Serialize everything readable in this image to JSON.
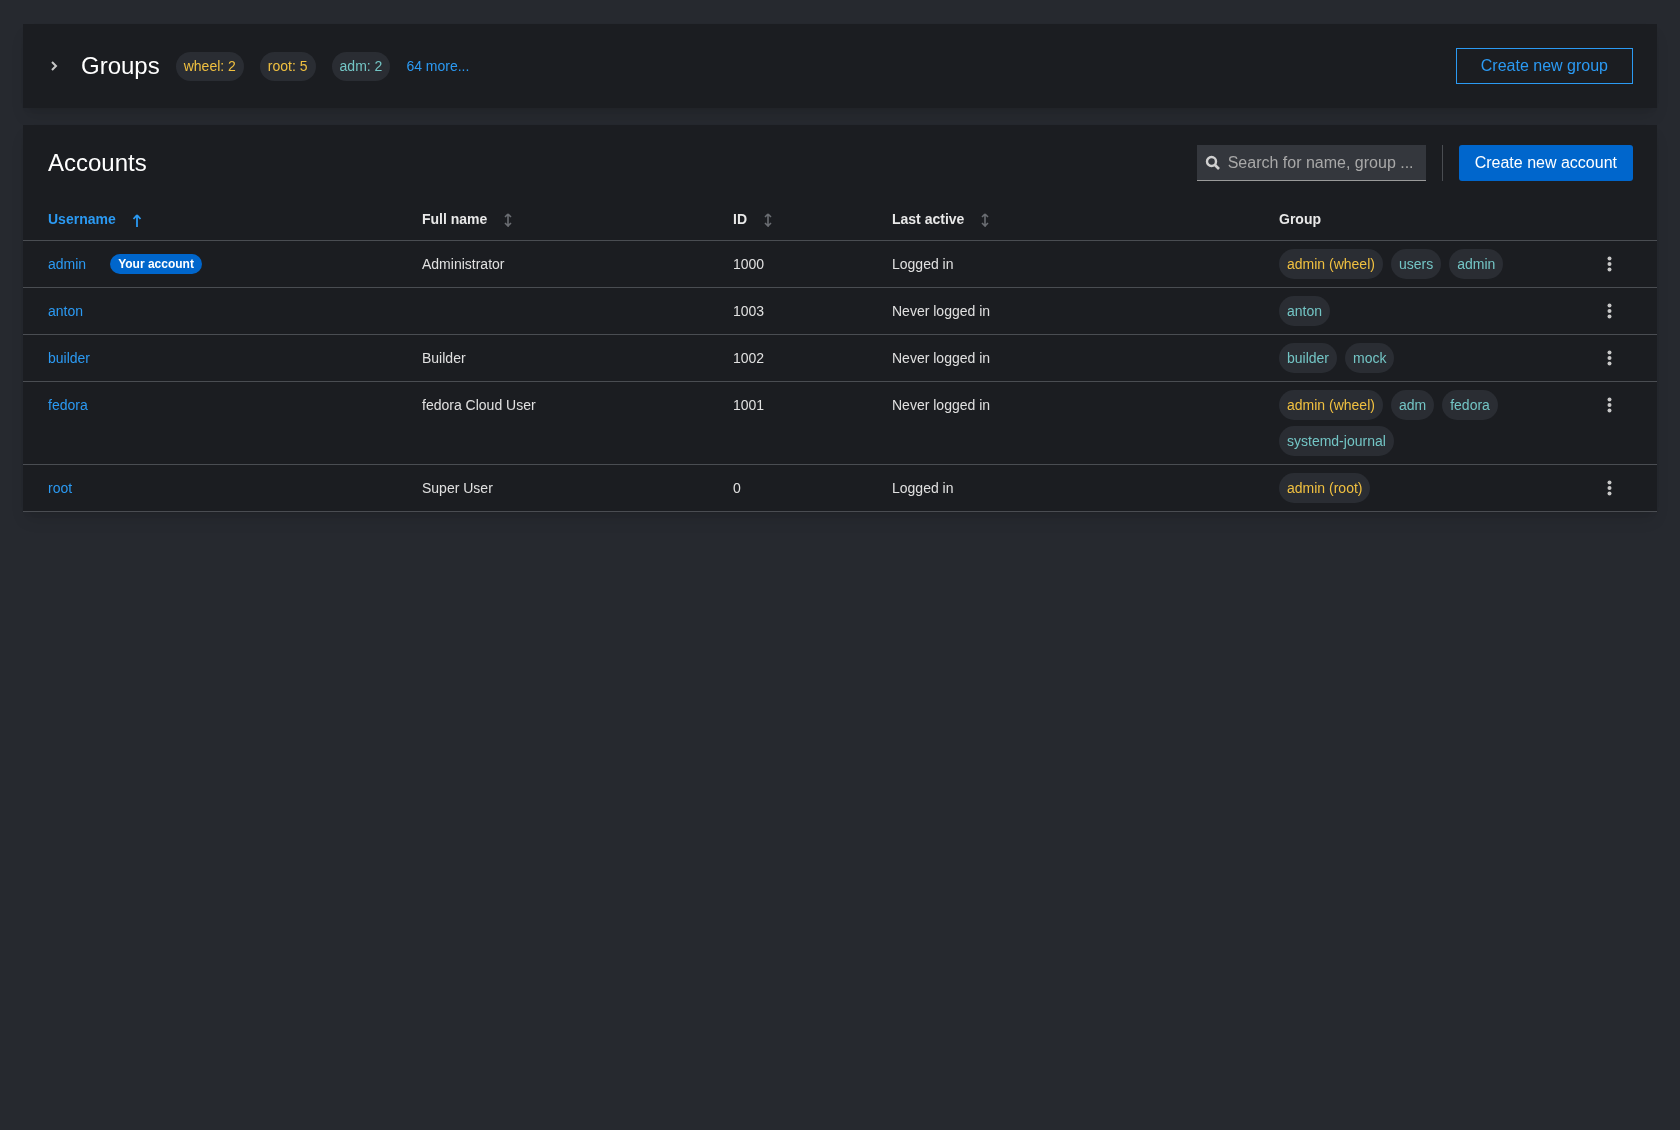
{
  "groups_card": {
    "title": "Groups",
    "expanded": false,
    "chips": [
      {
        "label": "wheel: 2",
        "color": "#f0c040"
      },
      {
        "label": "root: 5",
        "color": "#f0c040"
      },
      {
        "label": "adm: 2",
        "color": "#73c5c5"
      }
    ],
    "more_link": "64 more...",
    "button": "Create new group"
  },
  "accounts": {
    "title": "Accounts",
    "search": {
      "placeholder": "Search for name, group ..."
    },
    "button": "Create new account",
    "columns": [
      {
        "label": "Username",
        "sortable": true,
        "selected": true
      },
      {
        "label": "Full name",
        "sortable": true,
        "selected": false
      },
      {
        "label": "ID",
        "sortable": true,
        "selected": false
      },
      {
        "label": "Last active",
        "sortable": true,
        "selected": false
      },
      {
        "label": "Group",
        "sortable": false,
        "selected": false
      }
    ],
    "rows": [
      {
        "username": "admin",
        "badge": "Your account",
        "full_name": "Administrator",
        "id": "1000",
        "last_active": "Logged in",
        "groups": [
          {
            "label": "admin (wheel)",
            "color": "#f0c040"
          },
          {
            "label": "users",
            "color": "#73c5c5"
          },
          {
            "label": "admin",
            "color": "#73c5c5"
          }
        ]
      },
      {
        "username": "anton",
        "full_name": "",
        "id": "1003",
        "last_active": "Never logged in",
        "groups": [
          {
            "label": "anton",
            "color": "#73c5c5"
          }
        ]
      },
      {
        "username": "builder",
        "full_name": "Builder",
        "id": "1002",
        "last_active": "Never logged in",
        "groups": [
          {
            "label": "builder",
            "color": "#73c5c5"
          },
          {
            "label": "mock",
            "color": "#73c5c5"
          }
        ]
      },
      {
        "username": "fedora",
        "full_name": "fedora Cloud User",
        "id": "1001",
        "last_active": "Never logged in",
        "groups": [
          {
            "label": "admin (wheel)",
            "color": "#f0c040"
          },
          {
            "label": "adm",
            "color": "#73c5c5"
          },
          {
            "label": "fedora",
            "color": "#73c5c5"
          },
          {
            "label": "systemd-journal",
            "color": "#73c5c5"
          }
        ]
      },
      {
        "username": "root",
        "full_name": "Super User",
        "id": "0",
        "last_active": "Logged in",
        "groups": [
          {
            "label": "admin (root)",
            "color": "#f0c040"
          }
        ]
      }
    ]
  }
}
